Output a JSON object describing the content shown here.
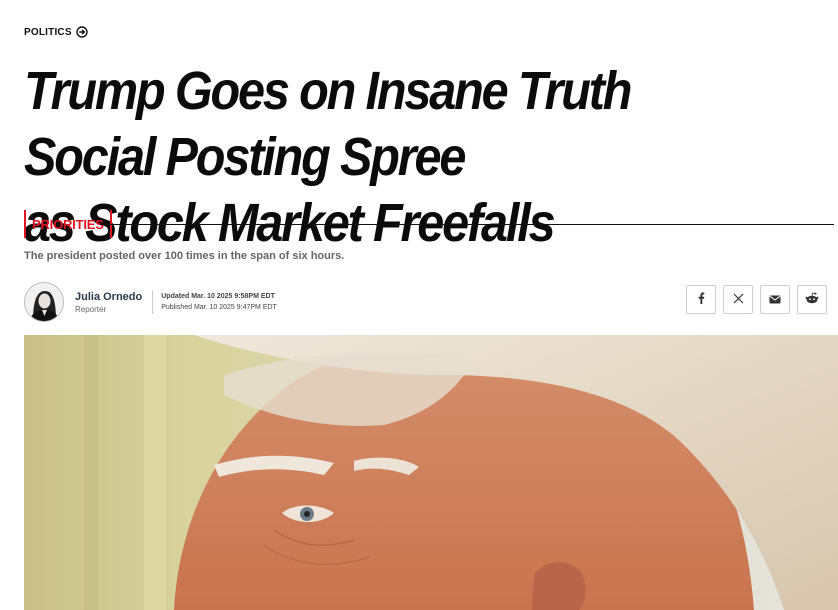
{
  "section": {
    "label": "POLITICS",
    "icon": "arrow-circle-right-icon"
  },
  "headline": {
    "line1": "Trump Goes on Insane Truth Social Posting Spree",
    "line2": "as Stock Market Freefalls"
  },
  "tag": {
    "label": "PRIORITIES",
    "color": "#e0141e"
  },
  "dek": "The president posted over 100 times in the span of six hours.",
  "byline": {
    "name": "Julia Ornedo",
    "role": "Reporter",
    "updated": "Updated Mar. 10 2025 9:58PM EDT",
    "published": "Published Mar. 10 2025 9:47PM EDT"
  },
  "share": [
    "facebook-icon",
    "x-icon",
    "mail-icon",
    "reddit-icon"
  ]
}
